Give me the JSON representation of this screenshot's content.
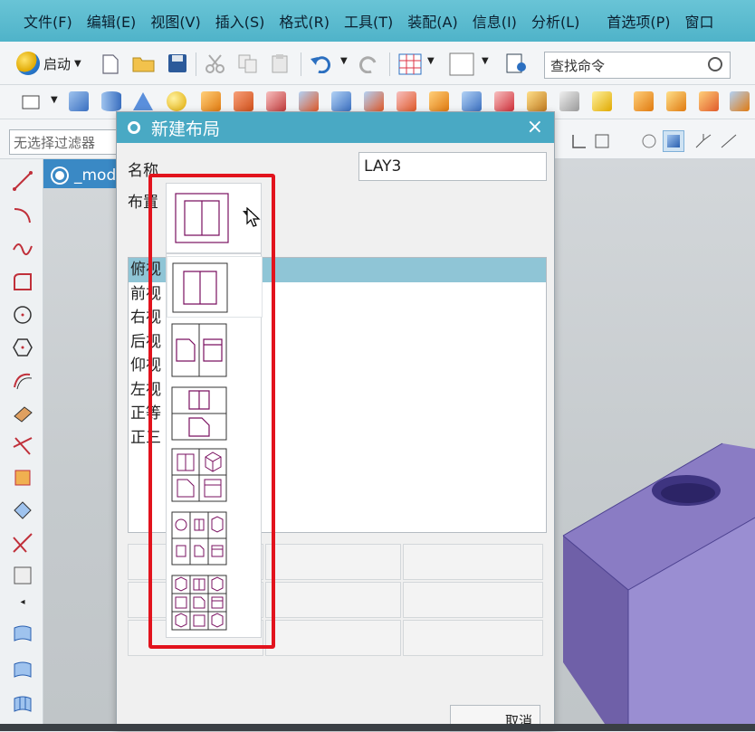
{
  "menubar": {
    "items": [
      "文件(F)",
      "编辑(E)",
      "视图(V)",
      "插入(S)",
      "格式(R)",
      "工具(T)",
      "装配(A)",
      "信息(I)",
      "分析(L)",
      "首选项(P)",
      "窗口"
    ]
  },
  "toolbar": {
    "start_label": "启动",
    "search_placeholder": "查找命令",
    "filter_value": "无选择过滤器"
  },
  "model_tab": {
    "label": "_mod"
  },
  "dialog": {
    "title": "新建布局",
    "close_glyph": "×",
    "name_label": "名称",
    "name_value": "LAY3",
    "layout_label": "布置",
    "views": [
      "俯视",
      "前视",
      "右视",
      "后视",
      "仰视",
      "左视",
      "正等",
      "正三"
    ],
    "cancel_label": "取消"
  },
  "layout_options": [
    {
      "id": "two-vertical",
      "panes": 2
    },
    {
      "id": "two-vertical-alt",
      "panes": 2
    },
    {
      "id": "two-horizontal",
      "panes": 2
    },
    {
      "id": "four-grid",
      "panes": 4
    },
    {
      "id": "six-grid",
      "panes": 6
    },
    {
      "id": "nine-grid",
      "panes": 9
    }
  ],
  "colors": {
    "menubar_bg": "#4fb3c9",
    "dialog_title_bg": "#49a9c4",
    "selected_row": "#8fc5d6",
    "highlight_red": "#e2131d",
    "model_face": "#8a7cc4",
    "layout_line": "#7a1060"
  }
}
